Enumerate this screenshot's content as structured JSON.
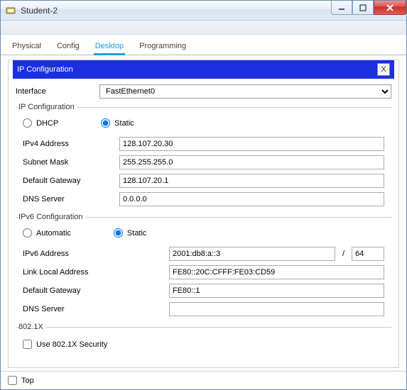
{
  "window": {
    "title": "Student-2"
  },
  "tabs": {
    "physical": "Physical",
    "config": "Config",
    "desktop": "Desktop",
    "programming": "Programming"
  },
  "panel": {
    "title": "IP Configuration",
    "close_glyph": "X"
  },
  "interface": {
    "label": "Interface",
    "selected": "FastEthernet0"
  },
  "ipv4": {
    "legend": "IP Configuration",
    "dhcp_label": "DHCP",
    "static_label": "Static",
    "mode": "static",
    "address_label": "IPv4 Address",
    "address": "128.107.20.30",
    "mask_label": "Subnet Mask",
    "mask": "255.255.255.0",
    "gateway_label": "Default Gateway",
    "gateway": "128.107.20.1",
    "dns_label": "DNS Server",
    "dns": "0.0.0.0"
  },
  "ipv6": {
    "legend": "IPv6 Configuration",
    "auto_label": "Automatic",
    "static_label": "Static",
    "mode": "static",
    "address_label": "IPv6 Address",
    "address": "2001:db8:a::3",
    "prefix_sep": "/",
    "prefix": "64",
    "linklocal_label": "Link Local Address",
    "linklocal": "FE80::20C:CFFF:FE03:CD59",
    "gateway_label": "Default Gateway",
    "gateway": "FE80::1",
    "dns_label": "DNS Server",
    "dns": ""
  },
  "dot1x": {
    "legend": "802.1X",
    "use_label": "Use 802.1X Security",
    "enabled": false
  },
  "footer": {
    "top_label": "Top",
    "top_checked": false
  }
}
